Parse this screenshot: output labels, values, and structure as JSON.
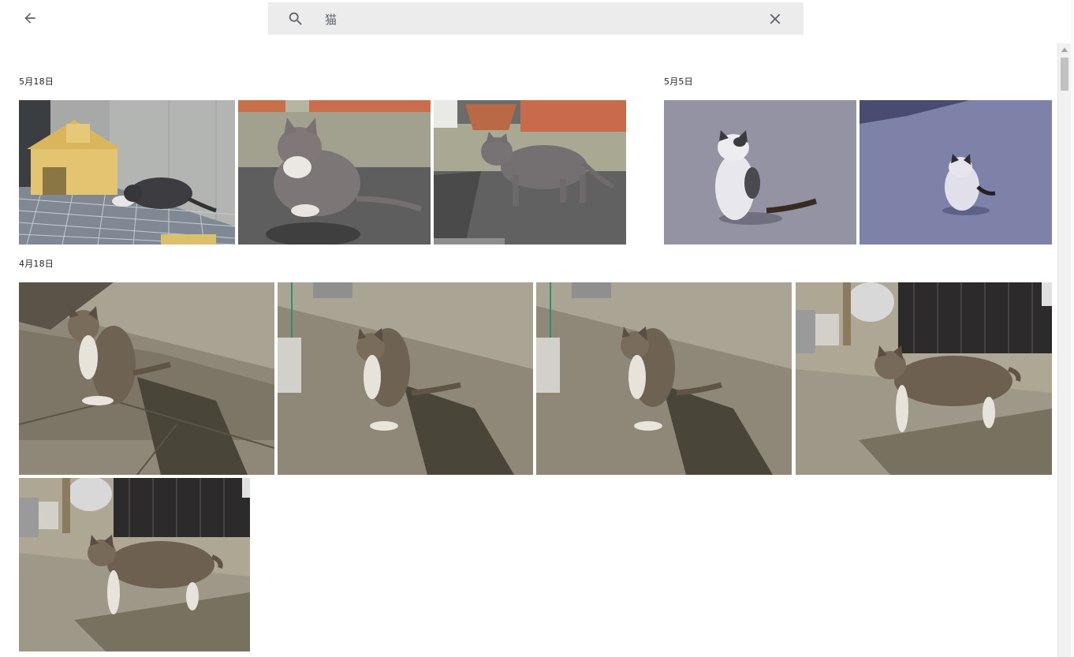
{
  "header": {
    "back_icon": "arrow-left-icon",
    "search_icon": "search-icon",
    "search_value": "猫",
    "clear_icon": "close-icon"
  },
  "groups": [
    {
      "date": "5月18日",
      "photos": [
        "cat-doghouse-bowl",
        "cat-sitting-grey",
        "cat-walking-grey"
      ]
    },
    {
      "date": "5月5日",
      "photos": [
        "cat-white-black-sitting",
        "cat-white-black-standing"
      ]
    },
    {
      "date": "4月18日",
      "photos": [
        "tabby-sitting-1",
        "tabby-sitting-2",
        "tabby-sitting-3",
        "tabby-walking-1",
        "tabby-walking-2"
      ]
    }
  ],
  "colors": {
    "search_bg": "#ececec",
    "icon": "#5f6368",
    "scrollbar_thumb": "#c1c1c1"
  }
}
